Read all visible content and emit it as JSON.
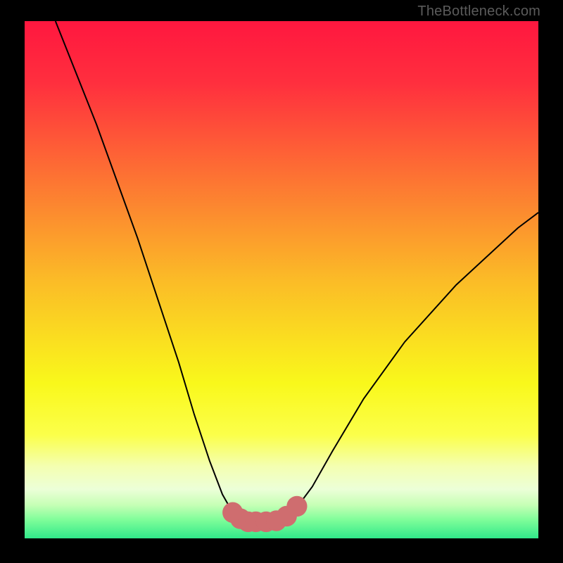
{
  "watermark": "TheBottleneck.com",
  "colors": {
    "black": "#000000",
    "curve": "#000000",
    "accent": "#cf6d6f",
    "watermark": "#5b5b5b"
  },
  "chart_data": {
    "type": "line",
    "title": "",
    "xlabel": "",
    "ylabel": "",
    "xlim": [
      0,
      100
    ],
    "ylim": [
      0,
      100
    ],
    "grid": false,
    "legend": false,
    "gradient_stops": [
      {
        "offset": 0.0,
        "color": "#ff173f"
      },
      {
        "offset": 0.12,
        "color": "#ff2f3e"
      },
      {
        "offset": 0.3,
        "color": "#fd7233"
      },
      {
        "offset": 0.5,
        "color": "#fbbb27"
      },
      {
        "offset": 0.7,
        "color": "#f9f81b"
      },
      {
        "offset": 0.8,
        "color": "#fbff4a"
      },
      {
        "offset": 0.86,
        "color": "#f4ffb0"
      },
      {
        "offset": 0.905,
        "color": "#ecffd8"
      },
      {
        "offset": 0.935,
        "color": "#c7ffb6"
      },
      {
        "offset": 0.965,
        "color": "#7dfd99"
      },
      {
        "offset": 1.0,
        "color": "#30e98a"
      }
    ],
    "series": [
      {
        "name": "bottleneck-curve",
        "x": [
          6,
          10,
          14,
          18,
          22,
          26,
          30,
          33,
          36,
          38.5,
          40.5,
          42,
          43.5,
          45,
          47,
          49,
          51,
          53,
          56,
          60,
          66,
          74,
          84,
          96,
          100
        ],
        "y": [
          100,
          90,
          80,
          69,
          58,
          46,
          34,
          24,
          15,
          8.5,
          5,
          3.5,
          3,
          3,
          3,
          3.3,
          4.2,
          6,
          10,
          17,
          27,
          38,
          49,
          60,
          63
        ]
      }
    ],
    "trough_markers": {
      "name": "trough-dots",
      "x": [
        40.5,
        42,
        43.5,
        45,
        47,
        49,
        51,
        53
      ],
      "y": [
        5,
        3.8,
        3.2,
        3.2,
        3.2,
        3.4,
        4.3,
        6.2
      ],
      "radius": 2.0
    }
  }
}
